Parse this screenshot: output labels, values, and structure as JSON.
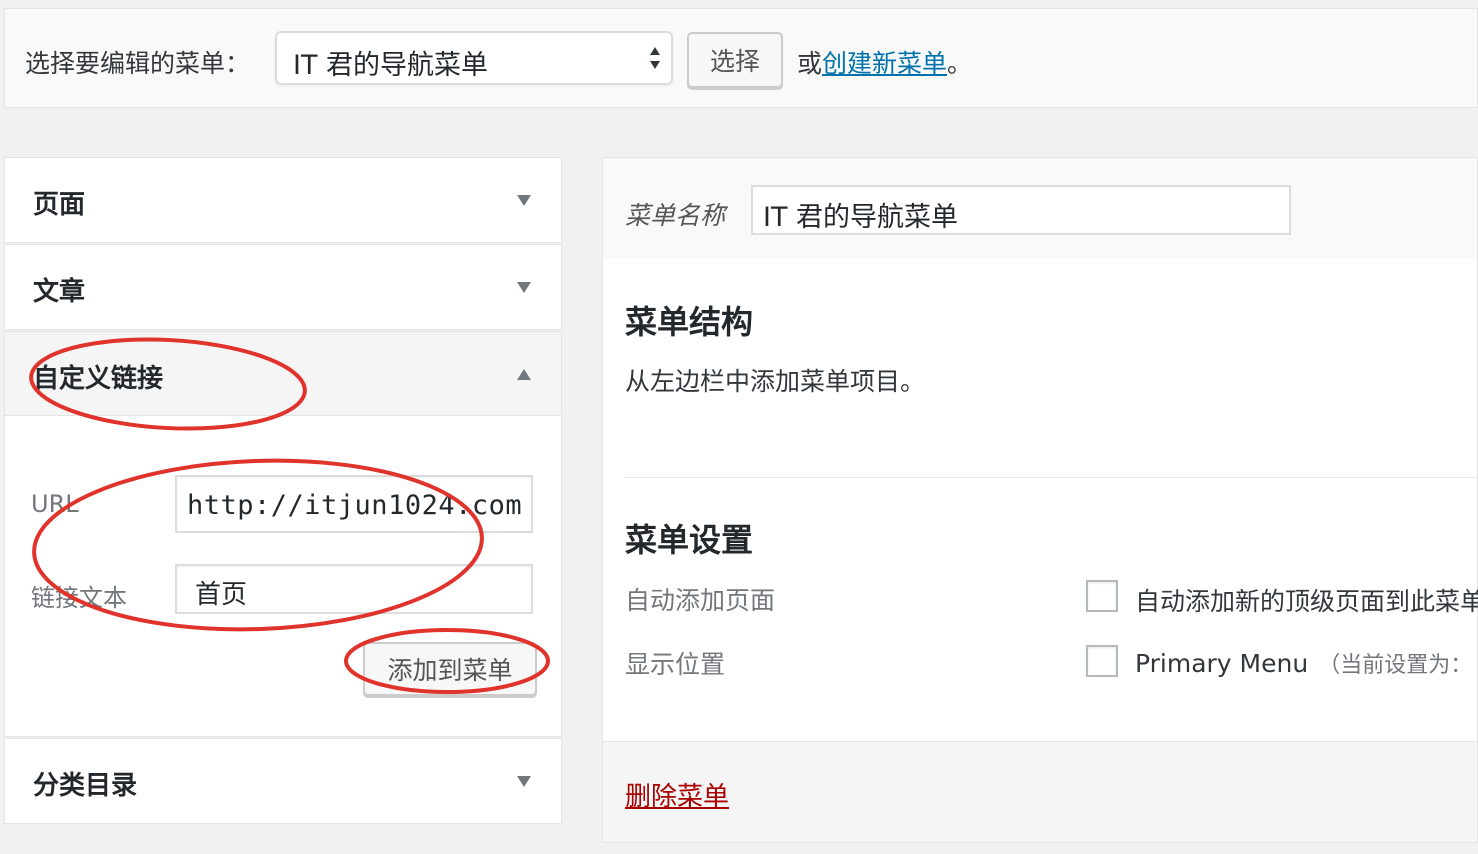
{
  "topbar": {
    "label": "选择要编辑的菜单：",
    "selected_menu": "IT 君的导航菜单",
    "select_button": "选择",
    "or_prefix": "或",
    "create_link": "创建新菜单",
    "or_suffix": "。"
  },
  "sidebar": {
    "sections": [
      {
        "title": "页面",
        "state": "collapsed"
      },
      {
        "title": "文章",
        "state": "collapsed"
      },
      {
        "title": "自定义链接",
        "state": "expanded"
      },
      {
        "title": "分类目录",
        "state": "collapsed"
      }
    ],
    "custom_link": {
      "url_label": "URL",
      "url_value": "http://itjun1024.com",
      "text_label": "链接文本",
      "text_value": "首页",
      "add_button": "添加到菜单"
    }
  },
  "menu_editor": {
    "name_label": "菜单名称",
    "name_value": "IT 君的导航菜单",
    "structure_title": "菜单结构",
    "structure_desc": "从左边栏中添加菜单项目。",
    "settings_title": "菜单设置",
    "auto_add_label": "自动添加页面",
    "auto_add_option": "自动添加新的顶级页面到此菜单",
    "location_label": "显示位置",
    "location_option": "Primary Menu",
    "location_note": "（当前设置为：",
    "delete_link": "删除菜单"
  },
  "colors": {
    "link": "#0073aa",
    "delete": "#aa0000",
    "annotation": "#e0332b"
  }
}
